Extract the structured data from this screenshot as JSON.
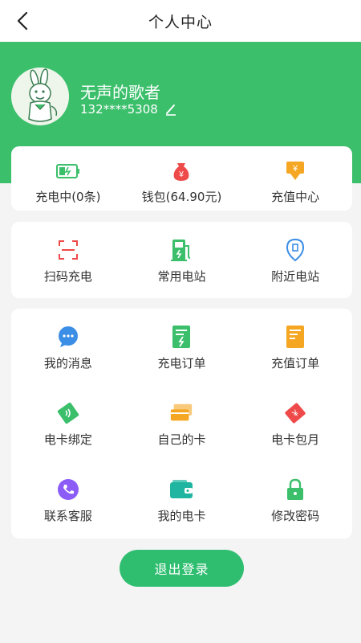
{
  "nav": {
    "title": "个人中心",
    "back_icon": "back-arrow-icon"
  },
  "profile": {
    "name": "无声的歌者",
    "phone": "132****5308",
    "avatar_icon": "donkey-avatar",
    "edit_icon": "edit-pencil-icon"
  },
  "summary": [
    {
      "label": "充电中(0条)",
      "icon": "battery-charging-icon",
      "color": "#3bbf6b"
    },
    {
      "label": "钱包(64.90元)",
      "icon": "wallet-bag-icon",
      "color": "#ef4a4a"
    },
    {
      "label": "充值中心",
      "icon": "recharge-icon",
      "color": "#f5a623"
    }
  ],
  "quick": [
    {
      "label": "扫码充电",
      "icon": "scan-icon",
      "color": "#ef4a4a"
    },
    {
      "label": "常用电站",
      "icon": "charging-station-icon",
      "color": "#3bbf6b"
    },
    {
      "label": "附近电站",
      "icon": "location-pin-icon",
      "color": "#3a8ee6"
    }
  ],
  "menu": [
    {
      "label": "我的消息",
      "icon": "message-bubble-icon",
      "color": "#3a8ee6"
    },
    {
      "label": "充电订单",
      "icon": "charge-order-icon",
      "color": "#3bbf6b"
    },
    {
      "label": "充值订单",
      "icon": "recharge-order-icon",
      "color": "#f5a623"
    },
    {
      "label": "电卡绑定",
      "icon": "card-bind-icon",
      "color": "#3bbf6b"
    },
    {
      "label": "自己的卡",
      "icon": "cards-icon",
      "color": "#f5a623"
    },
    {
      "label": "电卡包月",
      "icon": "monthly-card-icon",
      "color": "#ef4a4a"
    },
    {
      "label": "联系客服",
      "icon": "phone-icon",
      "color": "#8b5cf6"
    },
    {
      "label": "我的电卡",
      "icon": "wallet-card-icon",
      "color": "#1fb5a0"
    },
    {
      "label": "修改密码",
      "icon": "lock-icon",
      "color": "#3bbf6b"
    }
  ],
  "logout": {
    "label": "退出登录"
  },
  "colors": {
    "brand": "#3bbf6b",
    "background": "#f4f4f4"
  }
}
